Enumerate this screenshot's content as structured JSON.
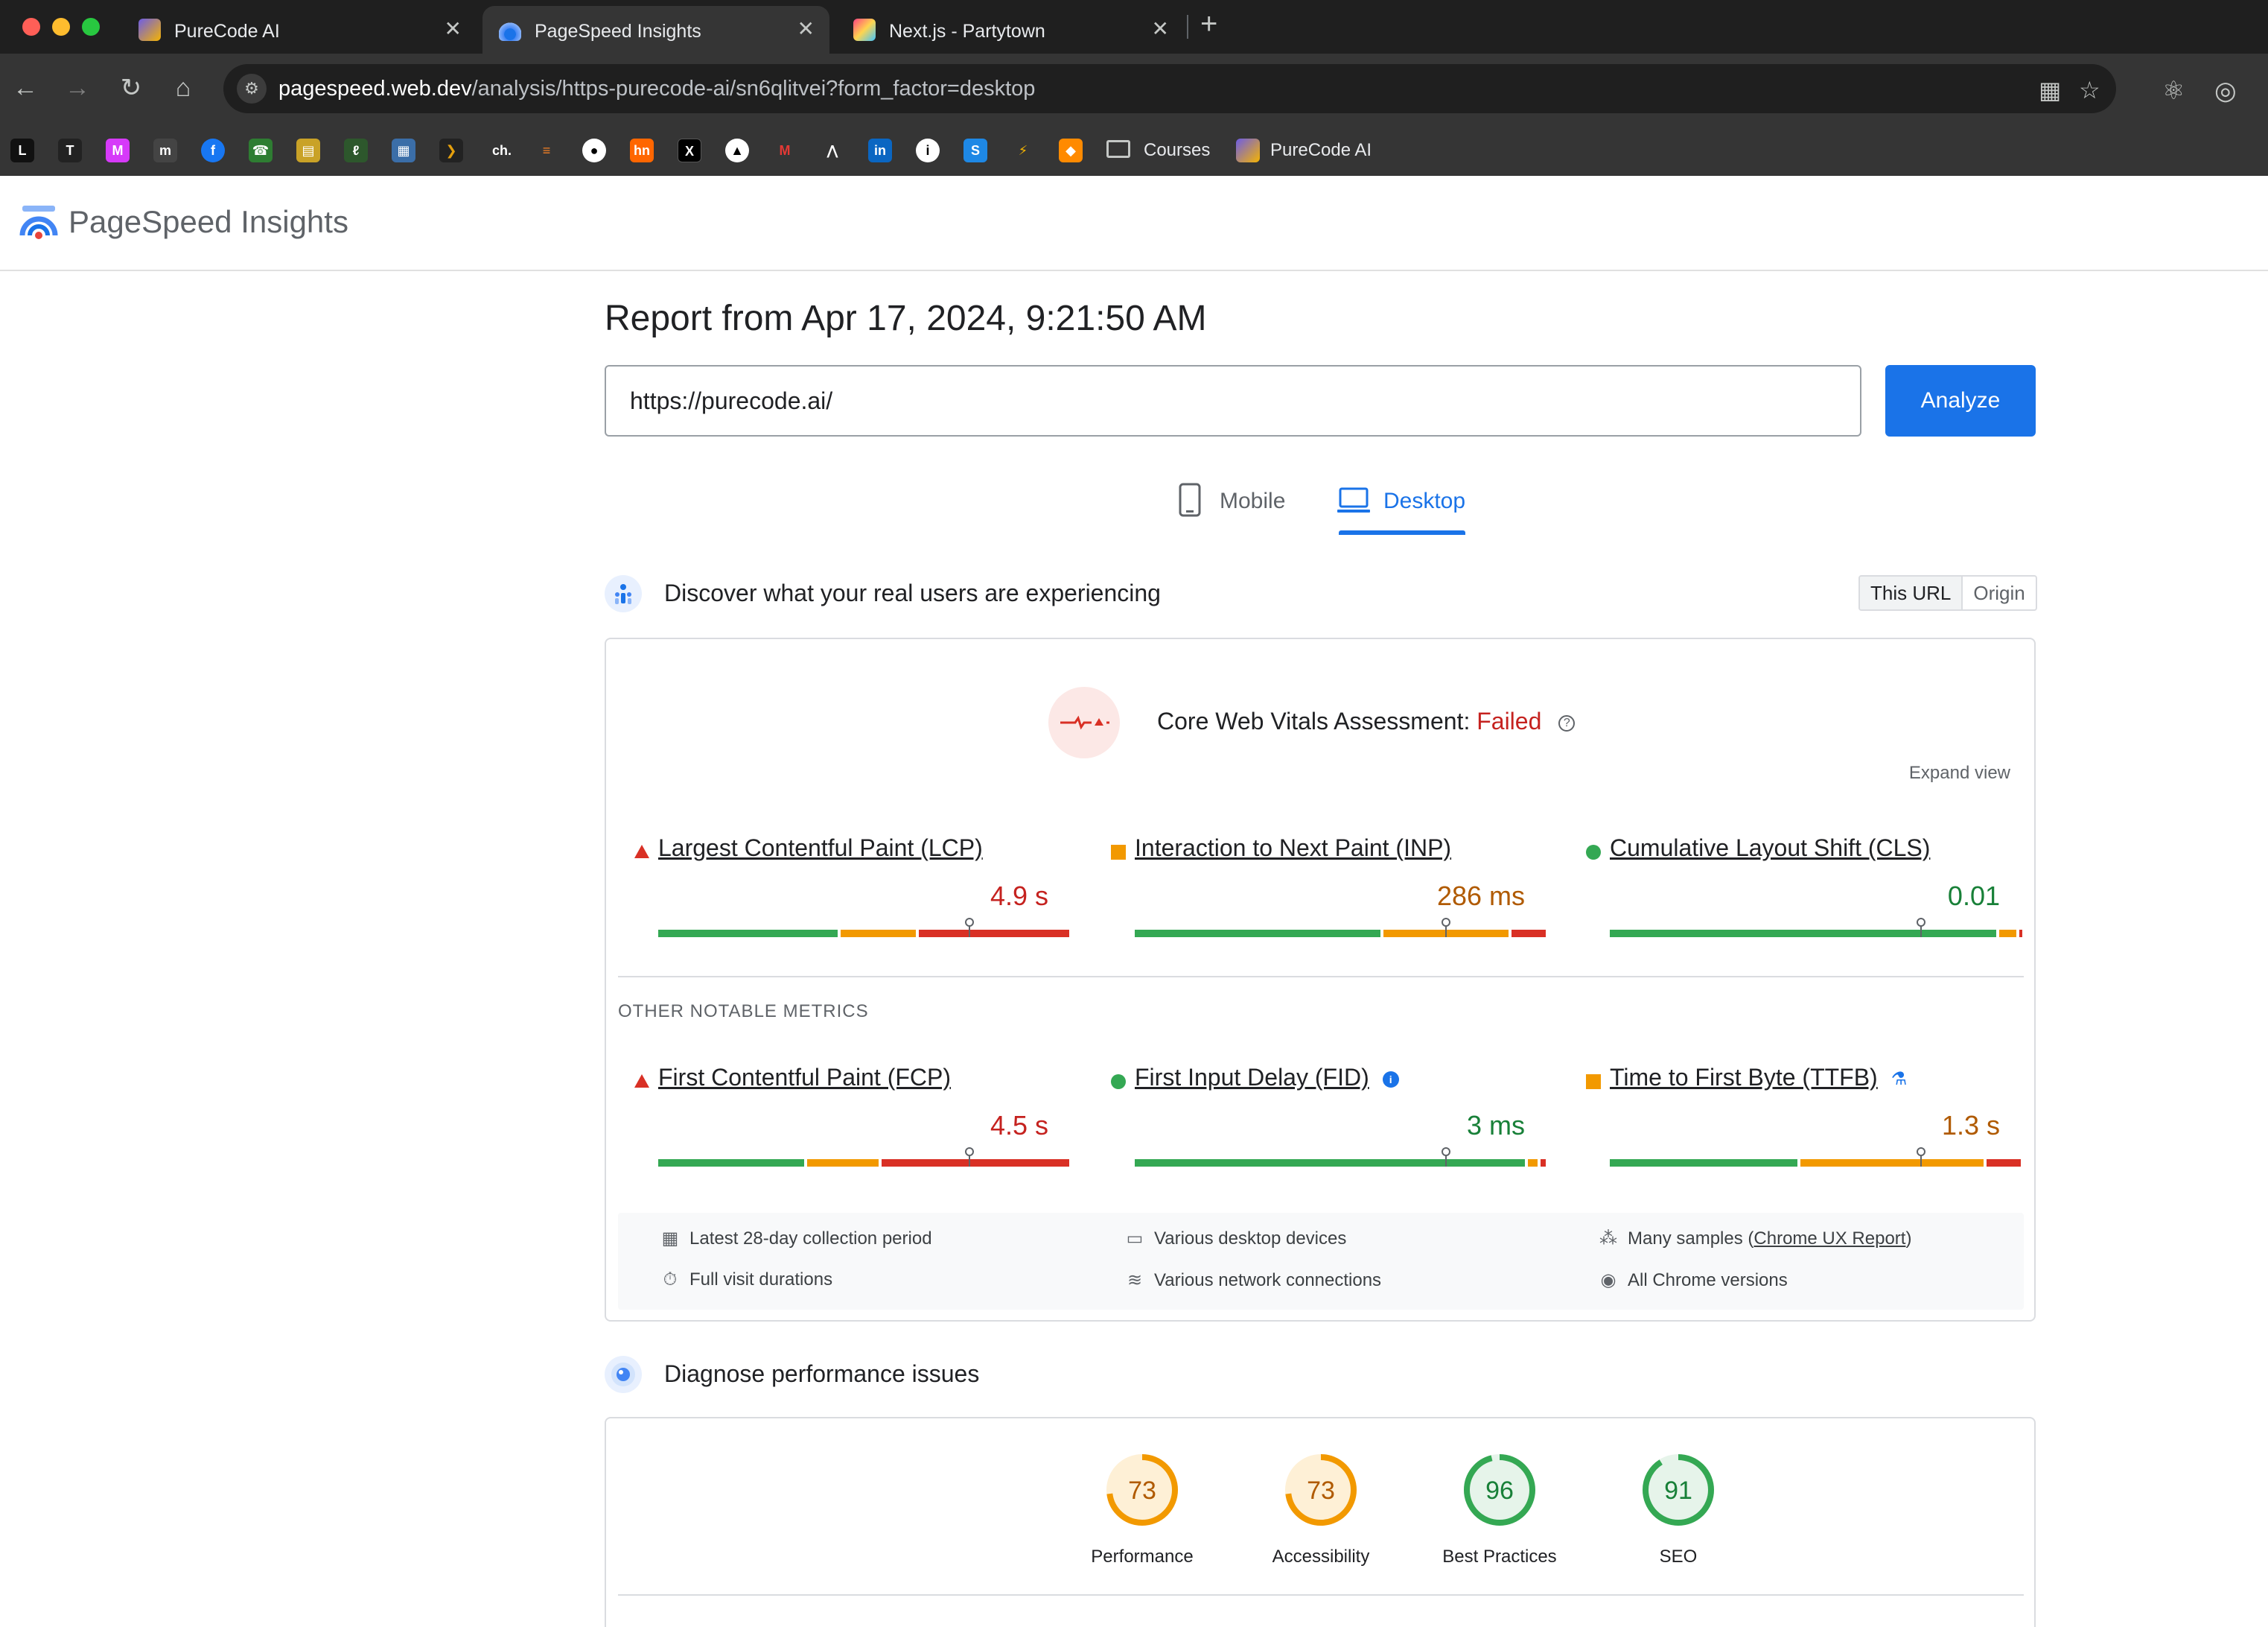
{
  "browser": {
    "tabs": [
      {
        "title": "PureCode AI",
        "active": false
      },
      {
        "title": "PageSpeed Insights",
        "active": true
      },
      {
        "title": "Next.js - Partytown",
        "active": false
      }
    ],
    "url_host": "pagespeed.web.dev",
    "url_path": "/analysis/https-purecode-ai/sn6qlitvei?form_factor=desktop",
    "bookmarks": [
      {
        "label": "Courses",
        "icon": "folder-icon"
      },
      {
        "label": "PureCode AI",
        "icon": "purecode-icon"
      }
    ]
  },
  "header": {
    "title": "PageSpeed Insights"
  },
  "report": {
    "title": "Report from Apr 17, 2024, 9:21:50 AM",
    "url_value": "https://purecode.ai/",
    "analyze_label": "Analyze"
  },
  "device_tabs": {
    "mobile": "Mobile",
    "desktop": "Desktop",
    "selected": "Desktop"
  },
  "field_data": {
    "section_title": "Discover what your real users are experiencing",
    "toggle": {
      "this_url": "This URL",
      "origin": "Origin",
      "selected": "This URL"
    },
    "assessment_label": "Core Web Vitals Assessment:",
    "assessment_result": "Failed",
    "expand_view": "Expand view",
    "other_metrics_label": "OTHER NOTABLE METRICS",
    "core_metrics": [
      {
        "name": "Largest Contentful Paint (LCP)",
        "value": "4.9 s",
        "status": "poor",
        "distribution": [
          0.44,
          0.19,
          0.37
        ],
        "marker": 0.75
      },
      {
        "name": "Interaction to Next Paint (INP)",
        "value": "286 ms",
        "status": "needs-improvement",
        "distribution": [
          0.6,
          0.31,
          0.09
        ],
        "marker": 0.75
      },
      {
        "name": "Cumulative Layout Shift (CLS)",
        "value": "0.01",
        "status": "good",
        "distribution": [
          0.94,
          0.05,
          0.01
        ],
        "marker": 0.75
      }
    ],
    "other_metrics": [
      {
        "name": "First Contentful Paint (FCP)",
        "value": "4.5 s",
        "status": "poor",
        "distribution": [
          0.36,
          0.18,
          0.46
        ],
        "marker": 0.75,
        "badge": ""
      },
      {
        "name": "First Input Delay (FID)",
        "value": "3 ms",
        "status": "good",
        "distribution": [
          0.95,
          0.03,
          0.02
        ],
        "marker": 0.75,
        "badge": "info"
      },
      {
        "name": "Time to First Byte (TTFB)",
        "value": "1.3 s",
        "status": "needs-improvement",
        "distribution": [
          0.46,
          0.45,
          0.09
        ],
        "marker": 0.75,
        "badge": "lab"
      }
    ],
    "footer": {
      "collection_period": "Latest 28-day collection period",
      "visit_durations": "Full visit durations",
      "devices": "Various desktop devices",
      "network": "Various network connections",
      "samples_prefix": "Many samples (",
      "samples_link": "Chrome UX Report",
      "samples_suffix": ")",
      "chrome_versions": "All Chrome versions"
    }
  },
  "diagnose": {
    "section_title": "Diagnose performance issues",
    "scores": [
      {
        "label": "Performance",
        "score": 73,
        "color": "#f29900",
        "track": "#fef0d6"
      },
      {
        "label": "Accessibility",
        "score": 73,
        "color": "#f29900",
        "track": "#fef0d6"
      },
      {
        "label": "Best Practices",
        "score": 96,
        "color": "#34a853",
        "track": "#e6f4ea"
      },
      {
        "label": "SEO",
        "score": 91,
        "color": "#34a853",
        "track": "#e6f4ea"
      }
    ]
  },
  "colors": {
    "accent": "#1a73e8",
    "poor": "#d93025",
    "needs_improvement": "#f29900",
    "good": "#34a853"
  }
}
